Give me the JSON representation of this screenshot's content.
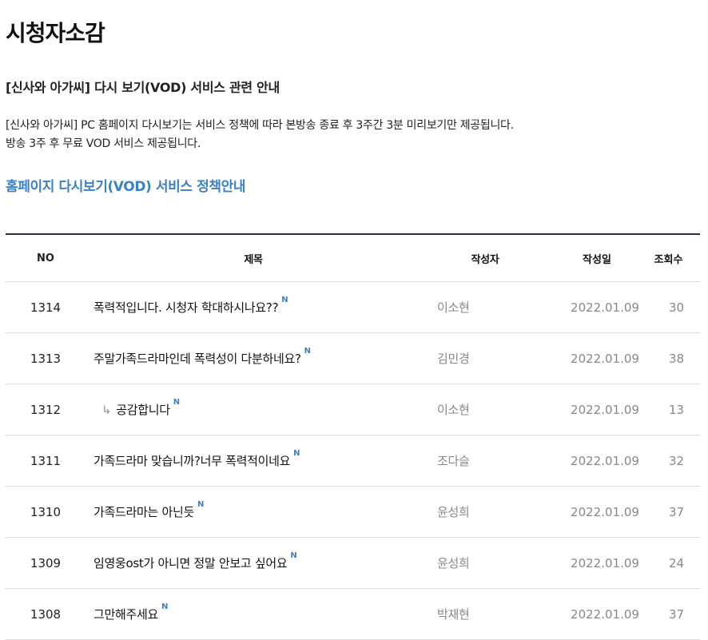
{
  "page": {
    "title": "시청자소감"
  },
  "notice": {
    "title": "[신사와 아가씨] 다시 보기(VOD) 서비스 관련 안내",
    "line1": "[신사와 아가씨]  PC 홈페이지 다시보기는 서비스 정책에 따라 본방송 종료 후 3주간 3분 미리보기만 제공됩니다.",
    "line2": "방송 3주 후 무료 VOD 서비스 제공됩니다.",
    "policy_link": "홈페이지 다시보기(VOD) 서비스 정책안내"
  },
  "board": {
    "headers": {
      "no": "NO",
      "title": "제목",
      "author": "작성자",
      "date": "작성일",
      "views": "조회수"
    },
    "new_badge": "N",
    "rows": [
      {
        "no": "1314",
        "title": "폭력적입니다. 시청자 학대하시나요??",
        "author": "이소현",
        "date": "2022.01.09",
        "views": "30",
        "reply": false
      },
      {
        "no": "1313",
        "title": "주말가족드라마인데 폭력성이 다분하네요?",
        "author": "김민경",
        "date": "2022.01.09",
        "views": "38",
        "reply": false
      },
      {
        "no": "1312",
        "title": "공감합니다",
        "author": "이소현",
        "date": "2022.01.09",
        "views": "13",
        "reply": true
      },
      {
        "no": "1311",
        "title": "가족드라마 맞습니까?너무 폭력적이네요",
        "author": "조다슬",
        "date": "2022.01.09",
        "views": "32",
        "reply": false
      },
      {
        "no": "1310",
        "title": "가족드라마는 아닌듯",
        "author": "윤성희",
        "date": "2022.01.09",
        "views": "37",
        "reply": false
      },
      {
        "no": "1309",
        "title": "임영웅ost가 아니면 정말 안보고 싶어요",
        "author": "윤성희",
        "date": "2022.01.09",
        "views": "24",
        "reply": false
      },
      {
        "no": "1308",
        "title": "그만해주세요",
        "author": "박재현",
        "date": "2022.01.09",
        "views": "37",
        "reply": false
      }
    ]
  },
  "colors": {
    "accent": "#3a82c8",
    "border_top": "#2d2d44",
    "muted_text": "#888888"
  },
  "icons": {
    "reply": "reply-arrow-icon"
  }
}
